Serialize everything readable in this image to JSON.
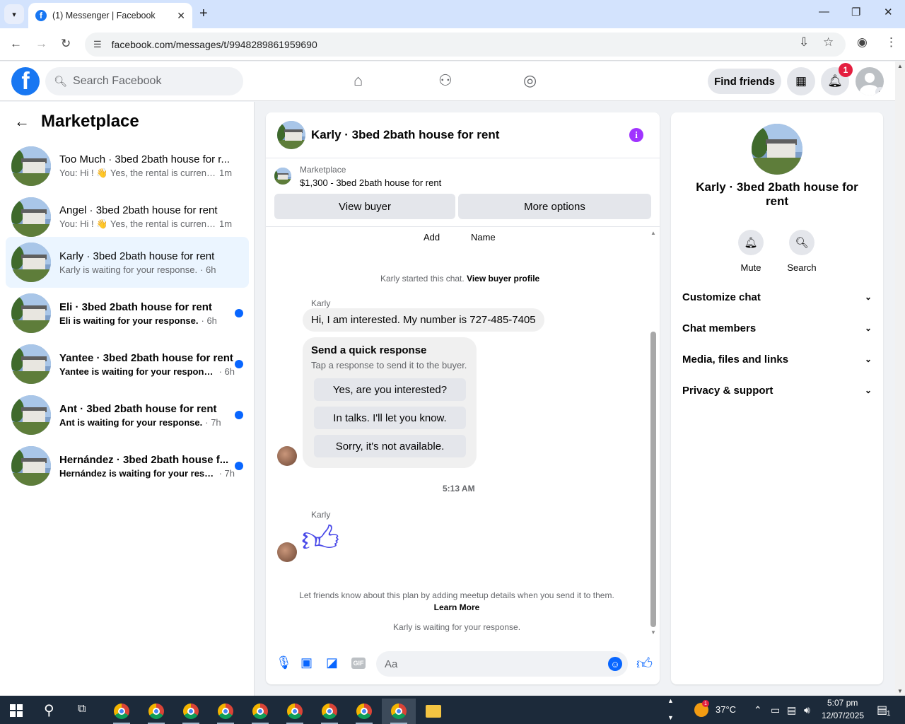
{
  "browser": {
    "tab_title": "(1) Messenger | Facebook",
    "url": "facebook.com/messages/t/9948289861959690"
  },
  "fb_nav": {
    "search_placeholder": "Search Facebook",
    "find_friends": "Find friends",
    "notification_count": "1"
  },
  "sidebar": {
    "title": "Marketplace",
    "conversations": [
      {
        "name": "Too Much · 3bed 2bath house for r...",
        "preview": "You: Hi ! 👋 Yes, the rental is currentl...",
        "time": "1m"
      },
      {
        "name": "Angel · 3bed 2bath house for rent",
        "preview": "You: Hi ! 👋 Yes, the rental is currentl...",
        "time": "1m"
      },
      {
        "name": "Karly · 3bed 2bath house for rent",
        "preview": "Karly is waiting for your response.",
        "time": "· 6h"
      },
      {
        "name": "Eli · 3bed 2bath house for rent",
        "preview": "Eli is waiting for your response.",
        "time": "· 6h"
      },
      {
        "name": "Yantee · 3bed 2bath house for rent",
        "preview": "Yantee is waiting for your response.",
        "time": "· 6h"
      },
      {
        "name": "Ant · 3bed 2bath house for rent",
        "preview": "Ant is waiting for your response.",
        "time": "· 7h"
      },
      {
        "name": "Hernández · 3bed 2bath house f...",
        "preview": "Hernández is waiting for your resp...",
        "time": "· 7h"
      }
    ]
  },
  "chat": {
    "title": "Karly · 3bed 2bath house for rent",
    "marketplace_label": "Marketplace",
    "listing": "$1,300 - 3bed 2bath house for rent",
    "view_buyer": "View buyer",
    "more_options": "More options",
    "add_label": "Add",
    "name_label": "Name",
    "started_text": "Karly started this chat.",
    "view_buyer_profile": "View buyer profile",
    "sender": "Karly",
    "message": "Hi, I am interested. My number is 727-485-7405",
    "quick_title": "Send a quick response",
    "quick_sub": "Tap a response to send it to the buyer.",
    "quick_responses": [
      "Yes, are you interested?",
      "In talks. I'll let you know.",
      "Sorry, it's not available."
    ],
    "timestamp": "5:13 AM",
    "sender2": "Karly",
    "meetup_text": "Let friends know about this plan by adding meetup details when you send it to them.",
    "learn_more": "Learn More",
    "waiting_text": "Karly is waiting for your response.",
    "composer_placeholder": "Aa"
  },
  "info": {
    "title": "Karly · 3bed 2bath house for rent",
    "mute": "Mute",
    "search": "Search",
    "rows": [
      "Customize chat",
      "Chat members",
      "Media, files and links",
      "Privacy & support"
    ]
  },
  "taskbar": {
    "temperature": "37°C",
    "time": "5:07 pm",
    "date": "12/07/2025",
    "notif_count": "1"
  },
  "colors": {
    "fb_blue": "#1877f2",
    "messenger_blue": "#0866ff",
    "active_conv": "#ebf5ff",
    "info_purple": "#a033ff"
  }
}
